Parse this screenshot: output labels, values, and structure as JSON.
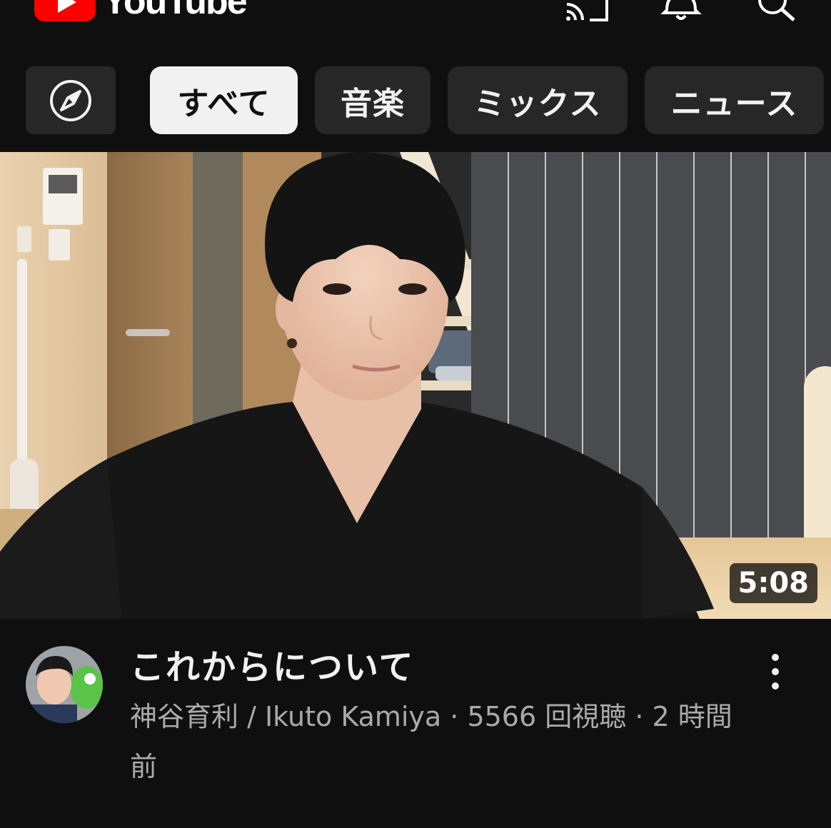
{
  "header": {
    "logo_text": "YouTube",
    "icons": [
      "cast-icon",
      "bell-icon",
      "search-icon"
    ]
  },
  "chips": {
    "explore_icon": "compass-icon",
    "items": [
      {
        "label": "すべて",
        "selected": true
      },
      {
        "label": "音楽",
        "selected": false
      },
      {
        "label": "ミックス",
        "selected": false
      },
      {
        "label": "ニュース",
        "selected": false
      }
    ]
  },
  "video": {
    "thumbnail": "video-thumbnail",
    "duration": "5:08",
    "title": "これからについて",
    "channel": "神谷育利 / Ikuto Kamiya",
    "views": "5566 回視聴",
    "age": "2 時間前",
    "separator": " · "
  },
  "colors": {
    "background": "#0f0f0f",
    "chip": "#272727",
    "chip_active": "#f1f1f1",
    "brand_red": "#ff0000",
    "secondary_text": "#aaaaaa"
  }
}
